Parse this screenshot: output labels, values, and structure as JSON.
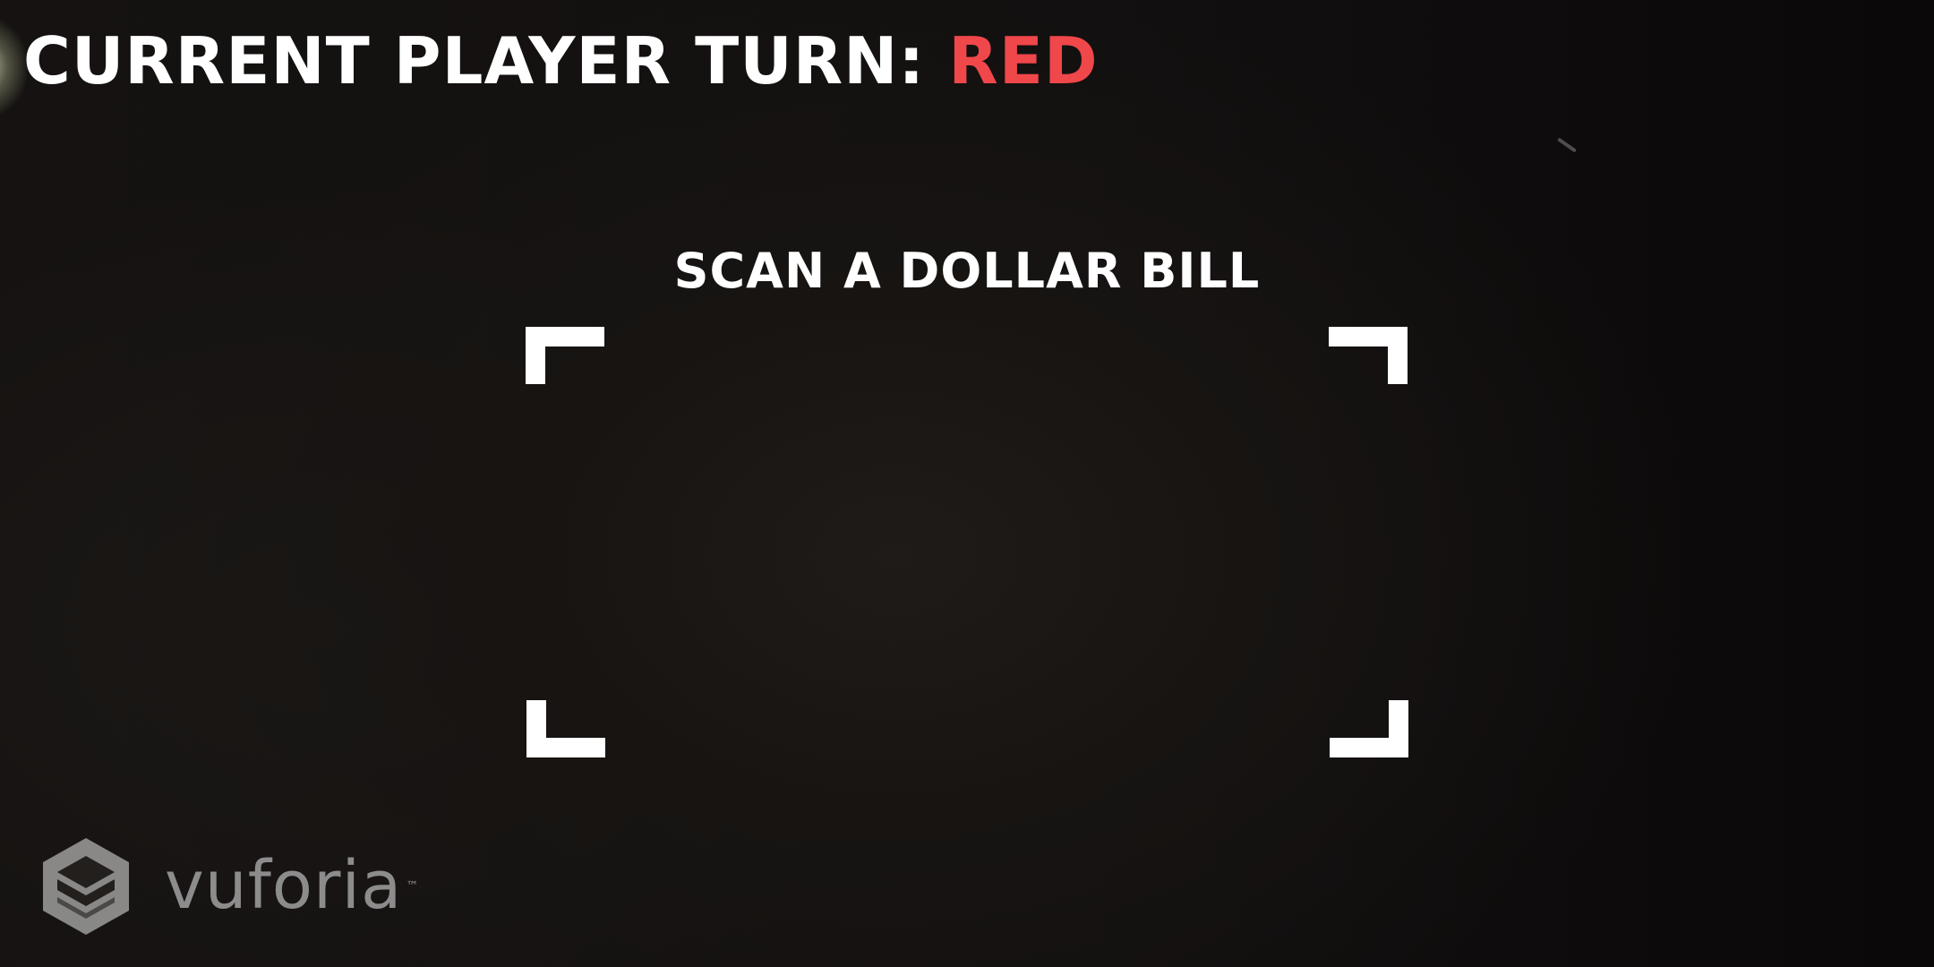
{
  "hud": {
    "turn_label": "CURRENT PLAYER TURN:",
    "turn_value": "RED",
    "turn_value_color": "#f0474a"
  },
  "scanner": {
    "instruction": "SCAN A DOLLAR BILL"
  },
  "watermark": {
    "brand": "vuforia",
    "trademark": "™",
    "icon": "vuforia-logo-icon"
  }
}
